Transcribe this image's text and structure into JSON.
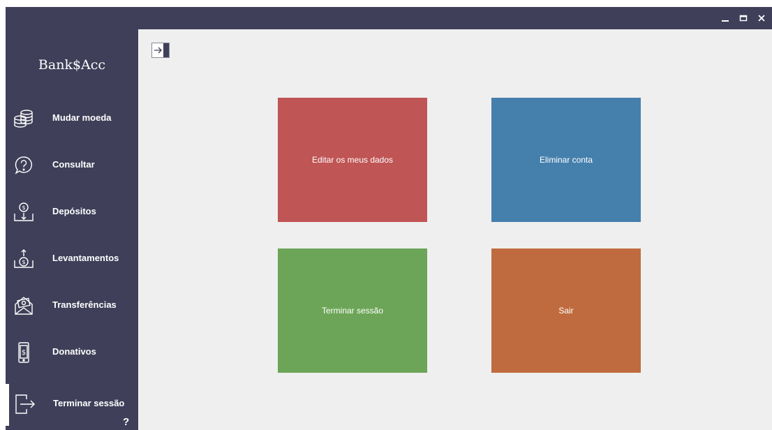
{
  "app": {
    "logo": "Bank$Acc"
  },
  "window_controls": {
    "minimize": "_",
    "maximize": "□",
    "close": "✕"
  },
  "sidebar": {
    "items": [
      {
        "label": "Mudar moeda",
        "icon": "coins-icon"
      },
      {
        "label": "Consultar",
        "icon": "question-chat-icon"
      },
      {
        "label": "Depósitos",
        "icon": "deposit-icon"
      },
      {
        "label": "Levantamentos",
        "icon": "withdraw-icon"
      },
      {
        "label": "Transferências",
        "icon": "money-envelope-icon"
      },
      {
        "label": "Donativos",
        "icon": "phone-dollar-icon"
      },
      {
        "label": "Terminar sessão",
        "icon": "logout-icon",
        "active": true
      }
    ],
    "help": "?"
  },
  "main": {
    "tiles": [
      {
        "label": "Editar os meus dados",
        "color": "#c05555"
      },
      {
        "label": "Eliminar conta",
        "color": "#4580ad"
      },
      {
        "label": "Terminar sessão",
        "color": "#6ca557"
      },
      {
        "label": "Sair",
        "color": "#c06b3f"
      }
    ]
  },
  "colors": {
    "sidebar_bg": "#3f3f59",
    "content_bg": "#efefef"
  }
}
